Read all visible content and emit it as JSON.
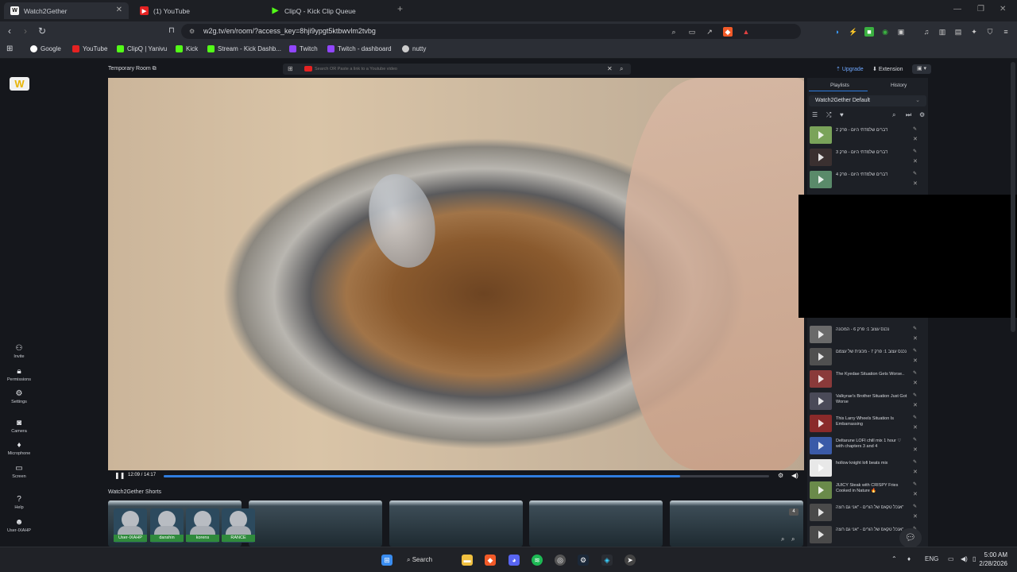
{
  "tabs": [
    {
      "label": "Watch2Gether",
      "active": true
    },
    {
      "label": "(1) YouTube",
      "active": false
    },
    {
      "label": "ClipQ - Kick Clip Queue",
      "active": false
    }
  ],
  "address": {
    "url": "w2g.tv/en/room/?access_key=8hji9ypgt5ktbwvlm2tvbg"
  },
  "bookmarks": [
    "Google",
    "YouTube",
    "ClipQ | Yanivu",
    "Kick",
    "Stream - Kick Dashb...",
    "Twitch",
    "Twitch - dashboard",
    "nutty"
  ],
  "room": {
    "name": "Temporary Room",
    "search_placeholder": "Search OR Paste a link to a Youtube video",
    "upgrade": "Upgrade",
    "extension": "Extension",
    "time": "12:09 / 14:17",
    "progress": 0.853,
    "shorts_title": "Watch2Gether Shorts",
    "shorts_count": "4"
  },
  "leftnav": [
    "Invite",
    "Permissions",
    "Settings",
    "Camera",
    "Microphone",
    "Screen",
    "Help",
    "User-IXAHP"
  ],
  "users": [
    "User-IXAHP",
    "danshin",
    "korens",
    "RANCE"
  ],
  "panel": {
    "tab_playlists": "Playlists",
    "tab_history": "History",
    "playlist_name": "Watch2Gether Default",
    "items_top": [
      {
        "title": "דברים שלמדתי היום - פרק 2",
        "color": "#7aa35a"
      },
      {
        "title": "דברים שלמדתי היום - פרק 3",
        "color": "#3a3030"
      },
      {
        "title": "דברים שלמדתי היום - פרק 4",
        "color": "#5a8a6a"
      }
    ],
    "items_bottom": [
      {
        "title": "נכנס עצוב 1: פרק 6 - המכונה",
        "color": "#6a6a6a"
      },
      {
        "title": "נכנס עצוב 1: פרק 7 - מכונית של עצמם",
        "color": "#505050"
      },
      {
        "title": "The Kyedae Situation Gets Worse..",
        "color": "#8a3a3a"
      },
      {
        "title": "Valkyrae's Brother Situation Just Got Worse",
        "color": "#4a4a58"
      },
      {
        "title": "This Larry Wheels Situation Is Embarrassing",
        "color": "#8a2a2a"
      },
      {
        "title": "Deltarune LOFI chill mix 1 hour ♡ with chapters 3 and 4",
        "color": "#3a5aa8"
      },
      {
        "title": "hollow knight lofi beats mix",
        "color": "#e8e8e8"
      },
      {
        "title": "JUICY Steak with CRISPY Fries Cooked in Nature 🔥",
        "color": "#6a8a4a"
      },
      {
        "title": "אנכל טקאס של הורים - \"אני גם רוצה\"",
        "color": "#4a4a4a"
      },
      {
        "title": "אנכל טקאס של הורים - \"אני גם רוצה\"",
        "color": "#4a4a4a"
      }
    ]
  },
  "taskbar": {
    "search": "Search",
    "lang": "ENG",
    "time": "5:00 AM",
    "date": "2/28/2026"
  }
}
